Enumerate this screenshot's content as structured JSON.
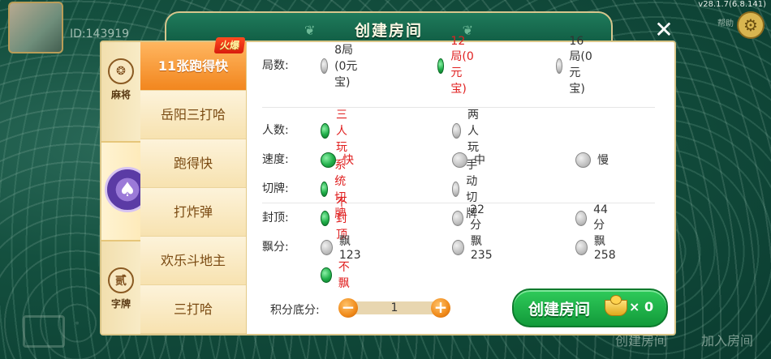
{
  "header": {
    "id_text": "ID:143919",
    "version": "v28.1.7(6.8.141)",
    "top_right_label": "帮助"
  },
  "dialog": {
    "title": "创建房间",
    "close_symbol": "✕"
  },
  "categories": [
    {
      "label": "麻将",
      "icon": "mahjong-icon",
      "glyph": "❂"
    },
    {
      "label": "",
      "icon": "poker-spade-icon",
      "glyph": "♠",
      "active": true
    },
    {
      "label": "字牌",
      "icon": "zipai-icon",
      "glyph": "贰"
    }
  ],
  "games": [
    {
      "label": "11张跑得快",
      "hot": "火爆",
      "active": true
    },
    {
      "label": "岳阳三打哈"
    },
    {
      "label": "跑得快"
    },
    {
      "label": "打炸弹"
    },
    {
      "label": "欢乐斗地主"
    },
    {
      "label": "三打哈"
    }
  ],
  "options": {
    "rounds": {
      "label": "局数:",
      "choices": [
        "8局(0元宝)",
        "12局(0元宝)",
        "16局(0元宝)"
      ],
      "selected": 1
    },
    "players": {
      "label": "人数:",
      "choices": [
        "三人玩",
        "两人玩"
      ],
      "selected": 0
    },
    "speed": {
      "label": "速度:",
      "choices": [
        "快",
        "中",
        "慢"
      ],
      "selected": 0
    },
    "cut": {
      "label": "切牌:",
      "choices": [
        "系统切牌",
        "手动切牌"
      ],
      "selected": 0
    },
    "cap": {
      "label": "封顶:",
      "choices": [
        "不封顶",
        "22分",
        "44分"
      ],
      "selected": 0
    },
    "float": {
      "label": "飘分:",
      "choices": [
        "飘123",
        "飘235",
        "飘258",
        "不飘"
      ],
      "selected": 3
    }
  },
  "score": {
    "label": "积分底分:",
    "value": "1",
    "minus": "−",
    "plus": "+"
  },
  "create": {
    "label": "创建房间",
    "cost": "× 0"
  },
  "bottom": {
    "create_room": "创建房间",
    "join_room": "加入房间"
  },
  "colors": {
    "accent_green": "#1fb04a",
    "selected_red": "#e02020",
    "tab_orange": "#f2861e",
    "gold": "#d9c588"
  }
}
